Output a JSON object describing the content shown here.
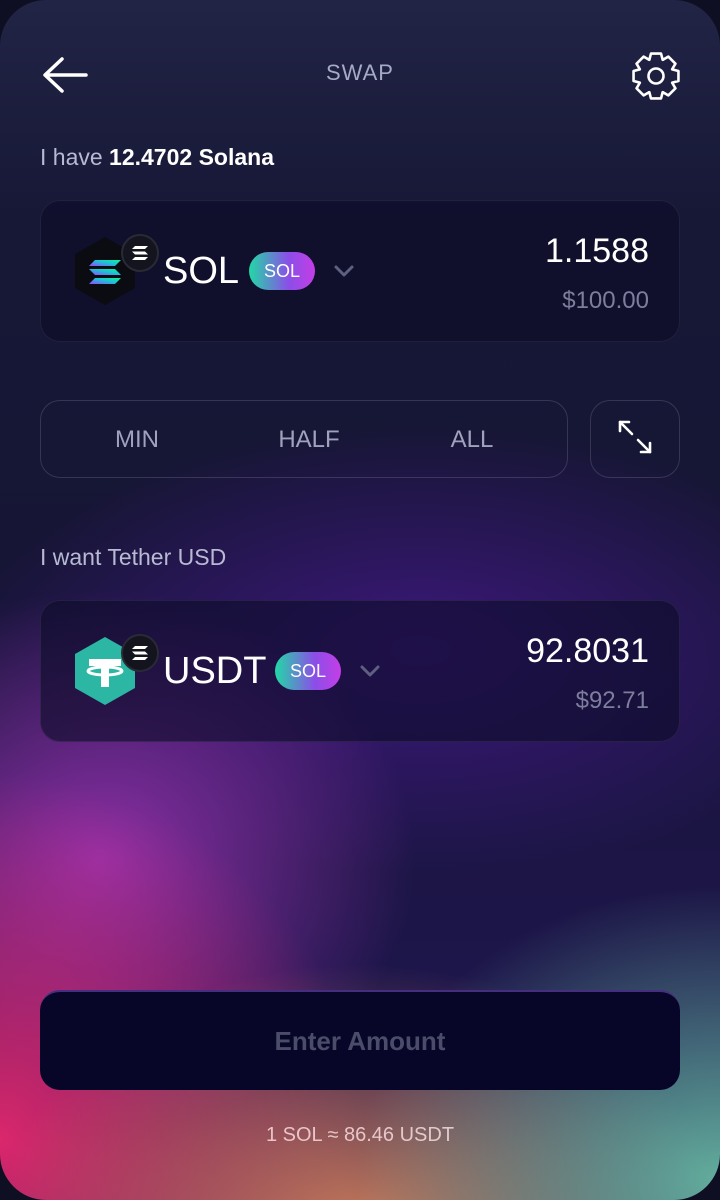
{
  "header": {
    "title": "SWAP",
    "back_icon": "arrow-left-icon",
    "settings_icon": "gear-icon"
  },
  "from": {
    "label_prefix": "I have",
    "balance": "12.4702 Solana",
    "token_symbol": "SOL",
    "network_badge": "SOL",
    "amount": "1.1588",
    "usd_value": "$100.00",
    "logo_icon": "solana-logo-icon"
  },
  "amount_presets": [
    "MIN",
    "HALF",
    "ALL"
  ],
  "swap_direction_icon": "swap-arrows-icon",
  "to": {
    "label": "I want Tether USD",
    "token_symbol": "USDT",
    "network_badge": "SOL",
    "amount": "92.8031",
    "usd_value": "$92.71",
    "logo_icon": "tether-logo-icon"
  },
  "cta_label": "Enter Amount",
  "rate": "1 SOL ≈ 86.46 USDT",
  "colors": {
    "accent_gradient_start": "#22d8a6",
    "accent_gradient_end": "#c43ee6",
    "tether": "#2bb7a3"
  }
}
